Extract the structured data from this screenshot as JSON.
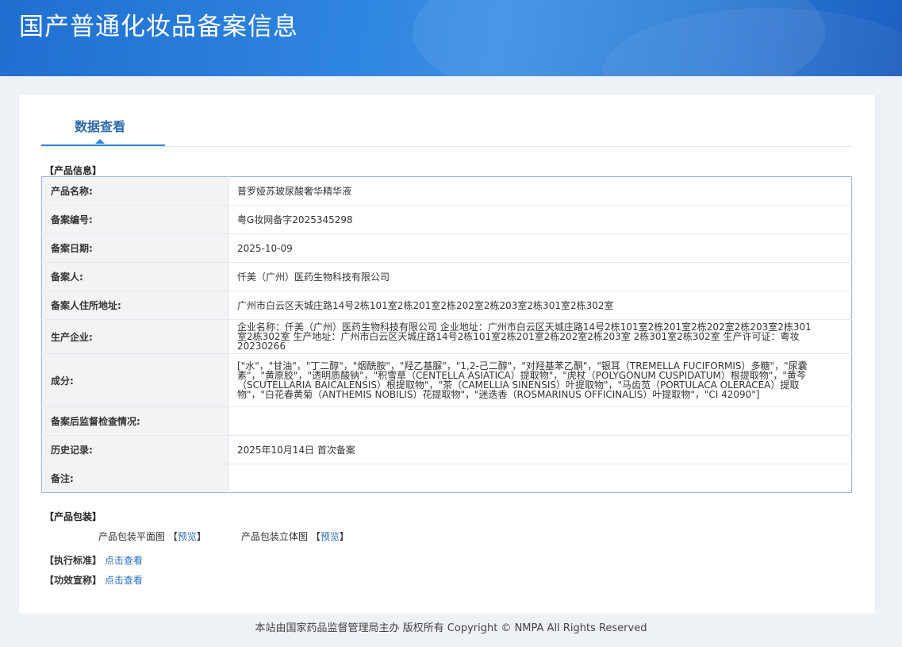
{
  "header": {
    "title": "国产普通化妆品备案信息"
  },
  "tabs": [
    {
      "label": "数据查看"
    }
  ],
  "product_info": {
    "section_title": "【产品信息】",
    "rows": [
      {
        "label": "产品名称:",
        "value": "普罗娅苏玻尿酸奢华精华液"
      },
      {
        "label": "备案编号:",
        "value": "粤G妆网备字2025345298"
      },
      {
        "label": "备案日期:",
        "value": "2025-10-09"
      },
      {
        "label": "备案人:",
        "value": "仟美（广州）医药生物科技有限公司"
      },
      {
        "label": "备案人住所地址:",
        "value": "广州市白云区天城庄路14号2栋101室2栋201室2栋202室2栋203室2栋301室2栋302室"
      },
      {
        "label": "生产企业:",
        "value": "企业名称：仟美（广州）医药生物科技有限公司 企业地址：广州市白云区天城庄路14号2栋101室2栋201室2栋202室2栋203室2栋301室2栋302室 生产地址：广州市白云区天城庄路14号2栋101室2栋201室2栋202室2栋203室 2栋301室2栋302室 生产许可证：粤妆20230266"
      },
      {
        "label": "成分:",
        "value": "[\"水\"，\"甘油\"，\"丁二醇\"，\"烟酰胺\"，\"羟乙基脲\"，\"1,2-己二醇\"，\"对羟基苯乙酮\"，\"银耳（TREMELLA FUCIFORMIS）多糖\"，\"尿囊素\"，\"黄原胶\"，\"透明质酸钠\"，\"积雪草（CENTELLA ASIATICA）提取物\"，\"虎杖（POLYGONUM CUSPIDATUM）根提取物\"，\"黄芩（SCUTELLARIA BAICALENSIS）根提取物\"，\"茶（CAMELLIA SINENSIS）叶提取物\"，\"马齿苋（PORTULACA OLERACEA）提取物\"，\"白花春黄菊（ANTHEMIS NOBILIS）花提取物\"，\"迷迭香（ROSMARINUS OFFICINALIS）叶提取物\"，\"CI 42090\"]"
      },
      {
        "label": "备案后监督检查情况:",
        "value": ""
      },
      {
        "label": "历史记录:",
        "value": "2025年10月14日 首次备案"
      },
      {
        "label": "备注:",
        "value": ""
      }
    ]
  },
  "packaging": {
    "section_title": "【产品包装】",
    "flat_label": "产品包装平面图",
    "solid_label": "产品包装立体图",
    "bracket_open": "【",
    "bracket_close": "】",
    "preview_link": "预览"
  },
  "standard": {
    "label": "【执行标准】",
    "link": "点击查看"
  },
  "efficacy": {
    "label": "【功效宣称】",
    "link": "点击查看"
  },
  "footer": {
    "text": "本站由国家药品监督管理局主办 版权所有 Copyright © NMPA All Rights Reserved"
  }
}
